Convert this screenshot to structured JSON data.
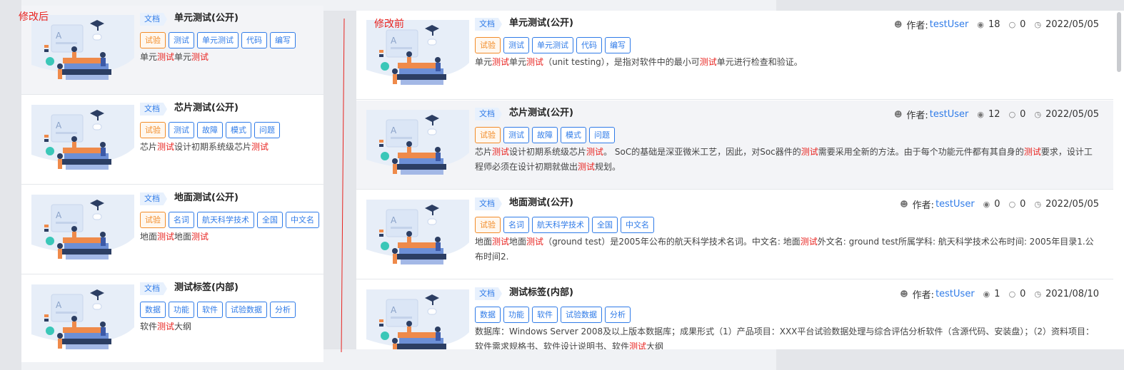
{
  "labels": {
    "after": "修改后",
    "before": "修改前"
  },
  "colors": {
    "accent": "#2f7be8",
    "highlight": "#e8231f",
    "tag_orange": "#f28c28",
    "divider_line": "#e8231f"
  },
  "icons": {
    "author": "user-icon",
    "views": "eye-icon",
    "comments": "comment-icon",
    "date": "clock-icon"
  },
  "author_label": "作者:",
  "after_cards": [
    {
      "badge": "文档",
      "title": "单元测试(公开)",
      "tags": [
        {
          "text": "试验",
          "style": "orange"
        },
        {
          "text": "测试",
          "style": "blue"
        },
        {
          "text": "单元测试",
          "style": "blue"
        },
        {
          "text": "代码",
          "style": "blue"
        },
        {
          "text": "编写",
          "style": "blue"
        }
      ],
      "desc": [
        {
          "t": "单元",
          "h": false
        },
        {
          "t": "测试",
          "h": true
        },
        {
          "t": "单元",
          "h": false
        },
        {
          "t": "测试",
          "h": true
        }
      ]
    },
    {
      "badge": "文档",
      "title": "芯片测试(公开)",
      "tags": [
        {
          "text": "试验",
          "style": "orange"
        },
        {
          "text": "测试",
          "style": "blue"
        },
        {
          "text": "故障",
          "style": "blue"
        },
        {
          "text": "模式",
          "style": "blue"
        },
        {
          "text": "问题",
          "style": "blue"
        }
      ],
      "desc": [
        {
          "t": "芯片",
          "h": false
        },
        {
          "t": "测试",
          "h": true
        },
        {
          "t": "设计初期系统级芯片",
          "h": false
        },
        {
          "t": "测试",
          "h": true
        }
      ]
    },
    {
      "badge": "文档",
      "title": "地面测试(公开)",
      "tags": [
        {
          "text": "试验",
          "style": "orange"
        },
        {
          "text": "名词",
          "style": "blue"
        },
        {
          "text": "航天科学技术",
          "style": "blue"
        },
        {
          "text": "全国",
          "style": "blue"
        },
        {
          "text": "中文名",
          "style": "blue"
        }
      ],
      "desc": [
        {
          "t": "地面",
          "h": false
        },
        {
          "t": "测试",
          "h": true
        },
        {
          "t": "地面",
          "h": false
        },
        {
          "t": "测试",
          "h": true
        }
      ]
    },
    {
      "badge": "文档",
      "title": "测试标签(内部)",
      "tags": [
        {
          "text": "数据",
          "style": "blue"
        },
        {
          "text": "功能",
          "style": "blue"
        },
        {
          "text": "软件",
          "style": "blue"
        },
        {
          "text": "试验数据",
          "style": "blue"
        },
        {
          "text": "分析",
          "style": "blue"
        }
      ],
      "desc": [
        {
          "t": "软件",
          "h": false
        },
        {
          "t": "测试",
          "h": true
        },
        {
          "t": "大纲",
          "h": false
        }
      ]
    }
  ],
  "before_cards": [
    {
      "badge": "文档",
      "title": "单元测试(公开)",
      "author": "testUser",
      "views": "18",
      "comments": "0",
      "date": "2022/05/05",
      "tags": [
        {
          "text": "试验",
          "style": "orange"
        },
        {
          "text": "测试",
          "style": "blue"
        },
        {
          "text": "单元测试",
          "style": "blue"
        },
        {
          "text": "代码",
          "style": "blue"
        },
        {
          "text": "编写",
          "style": "blue"
        }
      ],
      "desc": [
        {
          "t": "单元",
          "h": false
        },
        {
          "t": "测试",
          "h": true
        },
        {
          "t": "单元",
          "h": false
        },
        {
          "t": "测试",
          "h": true
        },
        {
          "t": "（unit testing），是指对软件中的最小可",
          "h": false
        },
        {
          "t": "测试",
          "h": true
        },
        {
          "t": "单元进行检查和验证。",
          "h": false
        }
      ]
    },
    {
      "badge": "文档",
      "title": "芯片测试(公开)",
      "author": "testUser",
      "views": "12",
      "comments": "0",
      "date": "2022/05/05",
      "tags": [
        {
          "text": "试验",
          "style": "orange"
        },
        {
          "text": "测试",
          "style": "blue"
        },
        {
          "text": "故障",
          "style": "blue"
        },
        {
          "text": "模式",
          "style": "blue"
        },
        {
          "text": "问题",
          "style": "blue"
        }
      ],
      "desc": [
        {
          "t": "芯片",
          "h": false
        },
        {
          "t": "测试",
          "h": true
        },
        {
          "t": "设计初期系统级芯片",
          "h": false
        },
        {
          "t": "测试",
          "h": true
        },
        {
          "t": "。 SoC的基础是深亚微米工艺，因此，对Soc器件的",
          "h": false
        },
        {
          "t": "测试",
          "h": true
        },
        {
          "t": "需要采用全新的方法。由于每个功能元件都有其自身的",
          "h": false
        },
        {
          "t": "测试",
          "h": true
        },
        {
          "t": "要求，设计工程师必须在设计初期就做出",
          "h": false
        },
        {
          "t": "测试",
          "h": true
        },
        {
          "t": "规划。",
          "h": false
        }
      ]
    },
    {
      "badge": "文档",
      "title": "地面测试(公开)",
      "author": "testUser",
      "views": "0",
      "comments": "0",
      "date": "2022/05/05",
      "tags": [
        {
          "text": "试验",
          "style": "orange"
        },
        {
          "text": "名词",
          "style": "blue"
        },
        {
          "text": "航天科学技术",
          "style": "blue"
        },
        {
          "text": "全国",
          "style": "blue"
        },
        {
          "text": "中文名",
          "style": "blue"
        }
      ],
      "desc": [
        {
          "t": "地面",
          "h": false
        },
        {
          "t": "测试",
          "h": true
        },
        {
          "t": "地面",
          "h": false
        },
        {
          "t": "测试",
          "h": true
        },
        {
          "t": "（ground test）是2005年公布的航天科学技术名词。中文名: 地面",
          "h": false
        },
        {
          "t": "测试",
          "h": true
        },
        {
          "t": "外文名: ground test所属学科: 航天科学技术公布时间: 2005年目录1.公布时间2.",
          "h": false
        }
      ]
    },
    {
      "badge": "文档",
      "title": "测试标签(内部)",
      "author": "testUser",
      "views": "1",
      "comments": "0",
      "date": "2021/08/10",
      "tags": [
        {
          "text": "数据",
          "style": "blue"
        },
        {
          "text": "功能",
          "style": "blue"
        },
        {
          "text": "软件",
          "style": "blue"
        },
        {
          "text": "试验数据",
          "style": "blue"
        },
        {
          "text": "分析",
          "style": "blue"
        }
      ],
      "desc": [
        {
          "t": "数据库：Windows Server 2008及以上版本数据库；成果形式（1）产品项目：XXX平台试验数据处理与综合评估分析软件（含源代码、安装盘）；（2）资料项目：软件需求规格书、软件设计说明书、软件",
          "h": false
        },
        {
          "t": "测试",
          "h": true
        },
        {
          "t": "大纲",
          "h": false
        }
      ]
    }
  ]
}
